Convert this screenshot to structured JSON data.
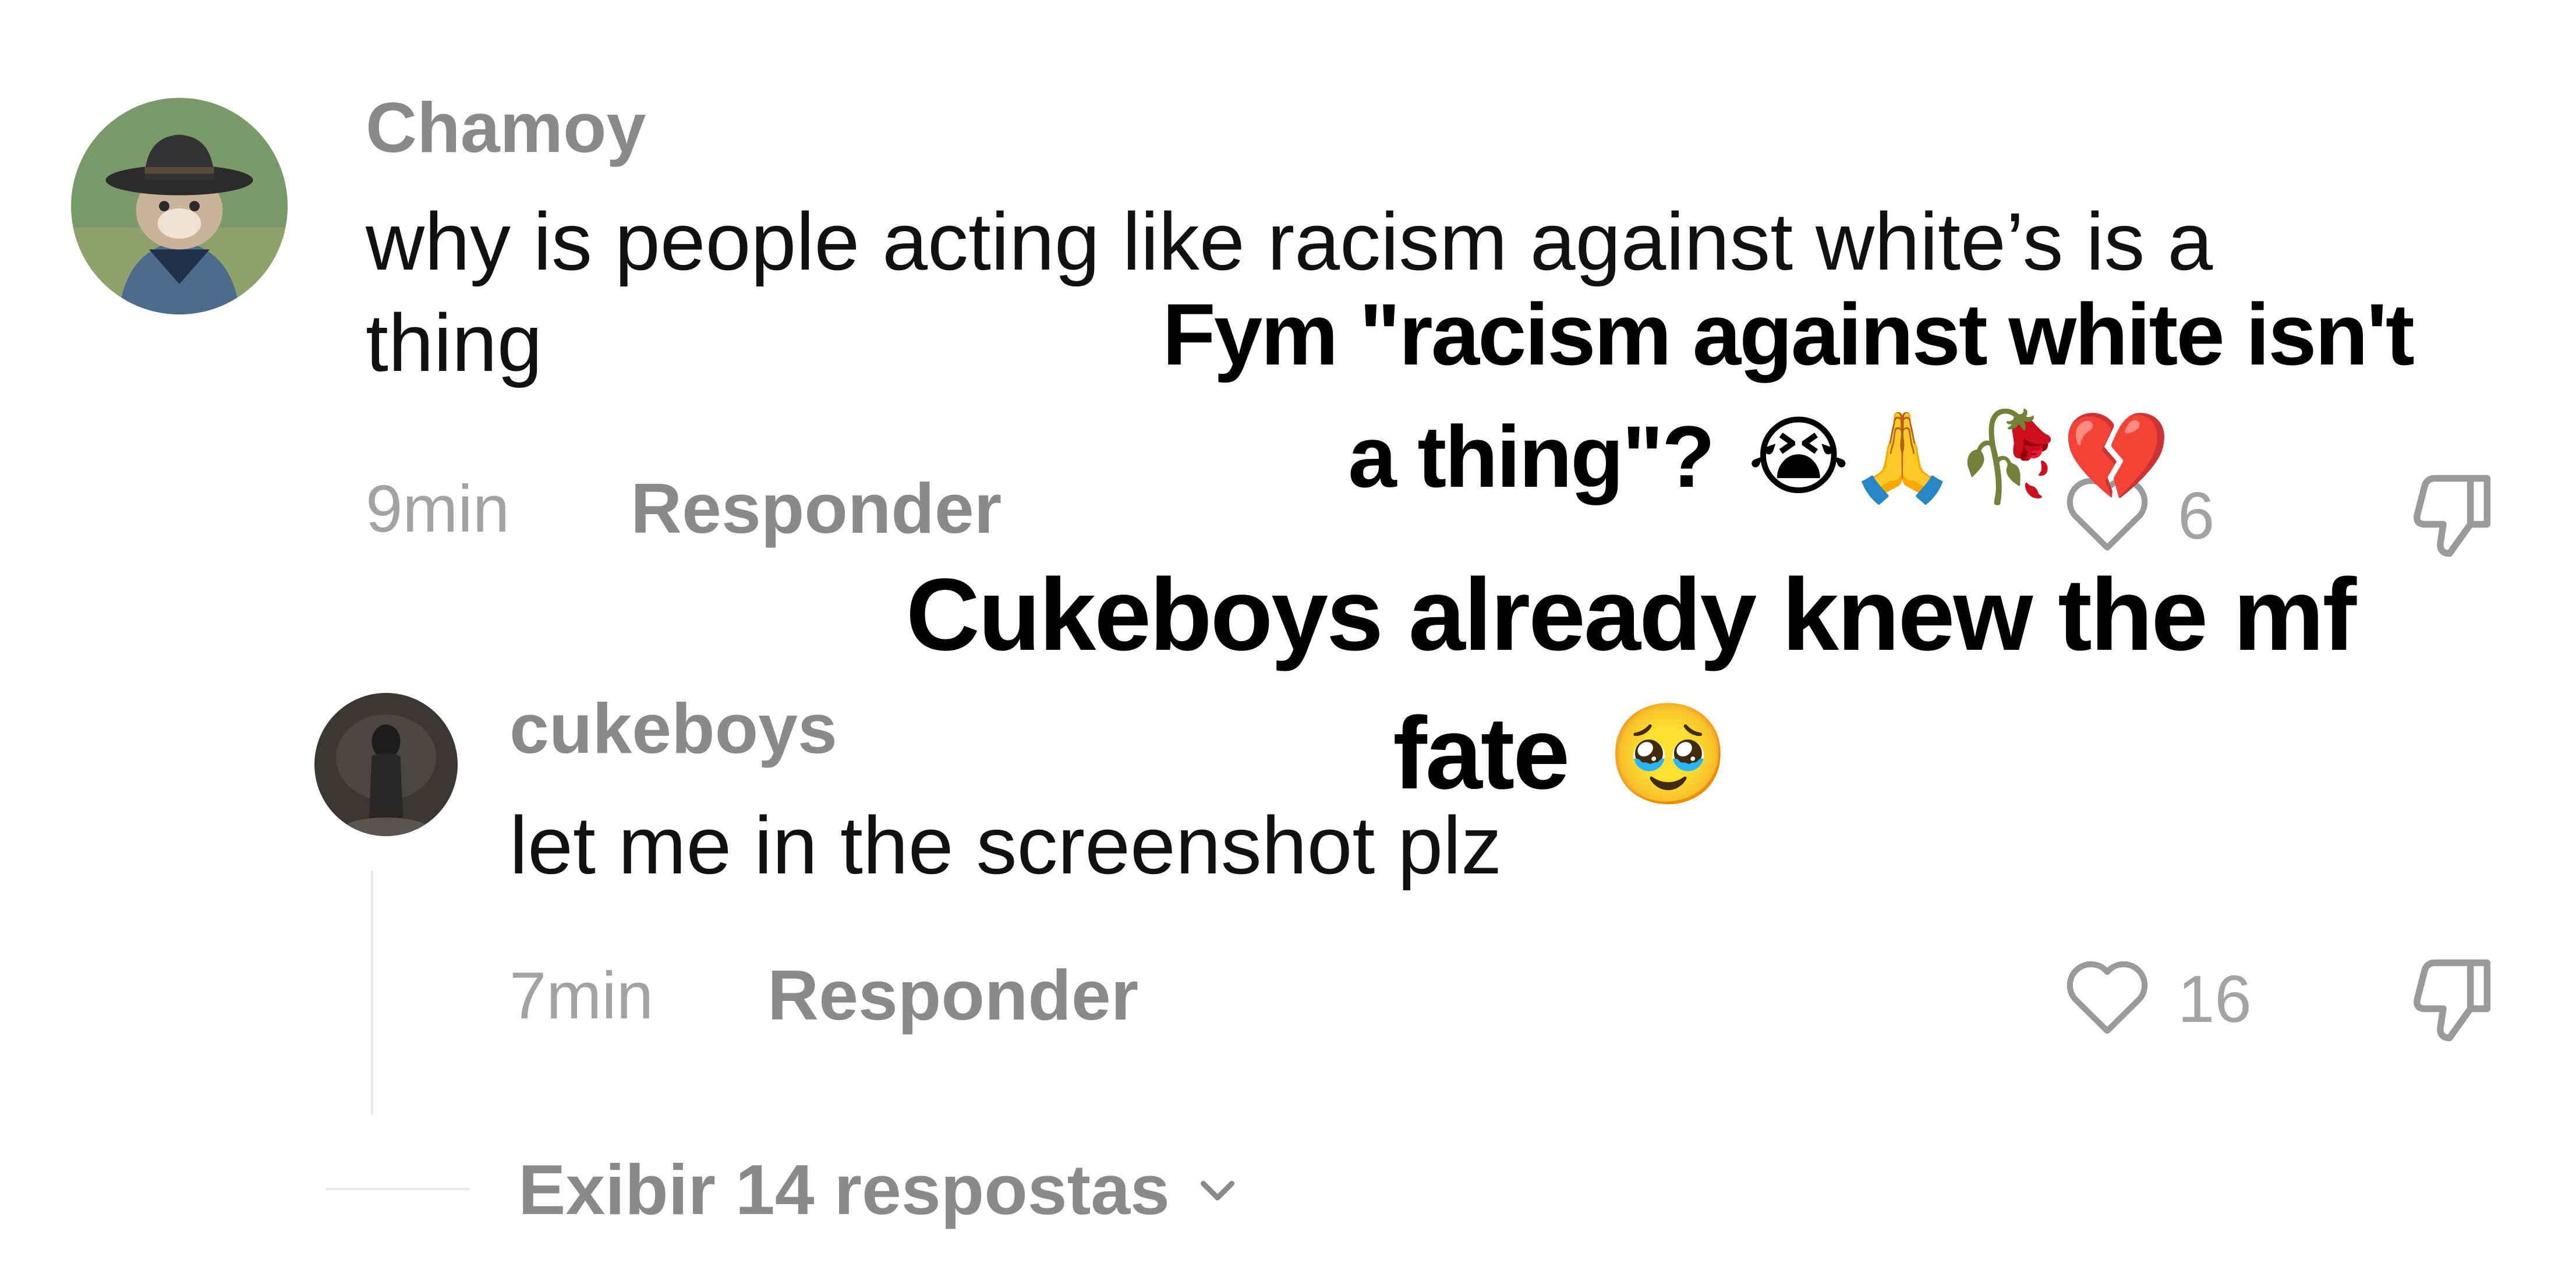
{
  "comments": [
    {
      "username": "Chamoy",
      "text_line1": "why is people acting like racism against white’s is a",
      "text_line2": "thing",
      "time": "9min",
      "reply_label": "Responder",
      "likes": "6"
    },
    {
      "username": "cukeboys",
      "text": "let me in the screenshot plz",
      "time": "7min",
      "reply_label": "Responder",
      "likes": "16"
    }
  ],
  "view_replies": {
    "label": "Exibir 14 respostas"
  },
  "overlay_captions": [
    {
      "line1": "Fym \"racism against white isn't",
      "line2": "a thing\"?",
      "emojis": "😭🙏🥀💔"
    },
    {
      "line1": "Cukeboys already knew the mf",
      "line2": "fate",
      "emojis": "🥹"
    }
  ],
  "icons": {
    "like": "heart-outline-icon",
    "dislike": "thumbs-down-icon",
    "expand": "chevron-down-icon"
  },
  "colors": {
    "username": "#8a8a8a",
    "comment_text": "#111111",
    "meta": "#a3a3a3",
    "overlay_text": "#000000",
    "thread_line": "#e5e5e5"
  }
}
